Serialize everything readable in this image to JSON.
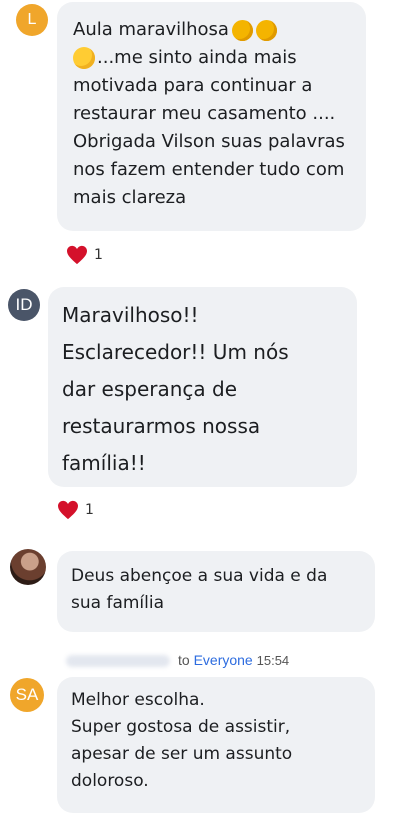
{
  "messages": [
    {
      "avatar_initials": "L",
      "avatar_color": "#f0a62b",
      "line1": "Aula maravilhosa",
      "rest": "...me sinto ainda mais\nmotivada para continuar a\nrestaurar meu casamento ....\nObrigada Vilson suas palavras\nnos fazem entender tudo com\nmais clareza",
      "reaction_count": "1"
    },
    {
      "avatar_initials": "ID",
      "avatar_color": "#4a5568",
      "text": "Maravilhoso!!\nEsclarecedor!! Um nós\ndar esperança de\nrestaurarmos nossa\nfamília!!",
      "reaction_count": "1"
    },
    {
      "text": "Deus abençoe a sua vida e da\nsua família"
    },
    {
      "avatar_initials": "SA",
      "avatar_color": "#f0a62b",
      "to_label": "to",
      "recipient": "Everyone",
      "time": "15:54",
      "text": "Melhor escolha.\nSuper gostosa de assistir,\napesar de ser um assunto\ndoloroso."
    }
  ],
  "colors": {
    "bubble": "#eff1f4",
    "heart": "#e0245e",
    "link": "#2d6cdf"
  },
  "icons": [
    "clapping-hands-icon",
    "hugging-face-icon",
    "heart-icon"
  ]
}
